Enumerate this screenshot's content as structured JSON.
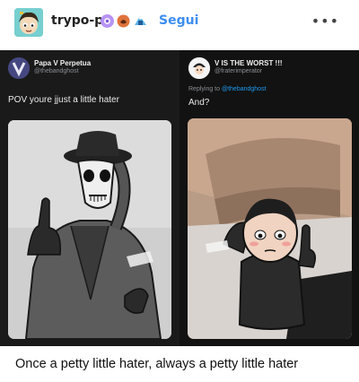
{
  "header": {
    "username": "trypo-p",
    "follow_label": "Segui",
    "more_label": "•••",
    "avatar_icon": "blog-avatar-icon",
    "badges": [
      "purple-badge-icon",
      "orange-badge-icon",
      "blue-badge-icon"
    ]
  },
  "tweets": {
    "left": {
      "name": "Papa V Perpetua",
      "handle": "@thebandghost",
      "text": "POV youre jjust a little hater",
      "menu": "..."
    },
    "right": {
      "name": "V IS THE WORST !!!",
      "handle": "@fraterimperator",
      "reply_prefix": "Replying to",
      "reply_mention": "@thebandghost",
      "text": "And?",
      "menu": "..."
    }
  },
  "caption": "Once a petty little hater, always a petty little hater",
  "colors": {
    "follow": "#3d8ef0",
    "mention": "#1d9bf0"
  }
}
